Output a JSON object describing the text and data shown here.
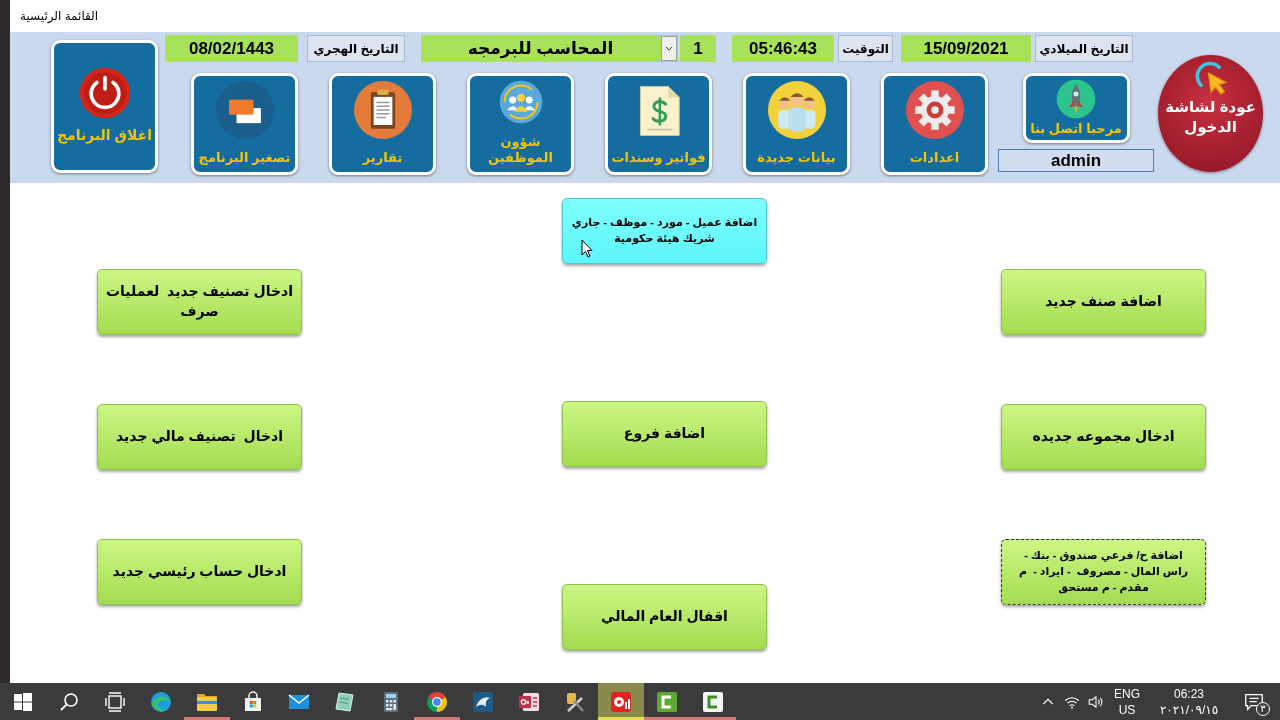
{
  "window": {
    "title": "القائمة الرئيسية"
  },
  "header": {
    "fields": [
      {
        "kind": "label",
        "text": "التاريخ الميلادي"
      },
      {
        "kind": "value",
        "text": "15/09/2021"
      },
      {
        "kind": "label",
        "text": "التوقيت"
      },
      {
        "kind": "value",
        "text": "05:46:43"
      },
      {
        "kind": "value",
        "text": "1"
      },
      {
        "kind": "combo",
        "text": "المحاسب للبرمجه"
      },
      {
        "kind": "label",
        "text": "التاريخ الهجري"
      },
      {
        "kind": "value",
        "text": "08/02/1443"
      }
    ],
    "login_button": {
      "label": "عودة لشاشة الدخول"
    },
    "user": {
      "tile_label": "مرحبا اتصل بنا",
      "username": "admin"
    },
    "tiles": [
      {
        "kind": "gear",
        "label": "اعدادات"
      },
      {
        "kind": "people",
        "label": "بيانات جديدة"
      },
      {
        "kind": "invoice",
        "label": "فواتير وسندات"
      },
      {
        "kind": "staff",
        "label": "شؤون الموظفين"
      },
      {
        "kind": "clipboard",
        "label": "تقارير"
      },
      {
        "kind": "windows",
        "label": "تصغير البرنامج"
      }
    ],
    "exit_button": {
      "label": "اغلاق البرنامج"
    }
  },
  "actions": {
    "columns": [
      {
        "buttons": [
          {
            "label": "اضافة صنف جديد",
            "hovered": false,
            "focused": false
          },
          {
            "label": "ادخال مجموعه جديده",
            "hovered": false,
            "focused": false
          },
          {
            "label": "اضافة ح/ فرعي صندوق - بنك - راس المال - مصروف  - ايراد -  م مقدم - م مستحق",
            "hovered": false,
            "focused": true
          }
        ]
      },
      {
        "buttons": [
          {
            "label": "اضافة عميل - مورد - موظف - جاري شريك هيئة حكومية",
            "hovered": true,
            "focused": false
          },
          {
            "label": "اضافة فروع",
            "hovered": false,
            "focused": false
          },
          {
            "label": "اقفال العام المالي",
            "hovered": false,
            "focused": false
          }
        ]
      },
      {
        "buttons": [
          {
            "label": "ادخال تصنيف جديد  لعمليات صرف",
            "hovered": false,
            "focused": false
          },
          {
            "label": "ادخال  تصنيف مالي جديد",
            "hovered": false,
            "focused": false
          },
          {
            "label": "ادخال حساب رئيسي جديد",
            "hovered": false,
            "focused": false
          }
        ]
      }
    ]
  },
  "taskbar": {
    "apps": [
      {
        "kind": "start",
        "running": false,
        "selected": false
      },
      {
        "kind": "search",
        "running": false,
        "selected": false
      },
      {
        "kind": "taskview",
        "running": false,
        "selected": false
      },
      {
        "kind": "edge",
        "running": false,
        "selected": false
      },
      {
        "kind": "explorer",
        "running": true,
        "selected": false
      },
      {
        "kind": "store",
        "running": false,
        "selected": false
      },
      {
        "kind": "mail",
        "running": false,
        "selected": false
      },
      {
        "kind": "notes",
        "running": false,
        "selected": false
      },
      {
        "kind": "calculator",
        "running": false,
        "selected": false
      },
      {
        "kind": "chrome",
        "running": true,
        "selected": false
      },
      {
        "kind": "database",
        "running": false,
        "selected": false
      },
      {
        "kind": "access",
        "running": false,
        "selected": false
      },
      {
        "kind": "tools",
        "running": false,
        "selected": false
      },
      {
        "kind": "recorder",
        "running": true,
        "selected": true
      },
      {
        "kind": "studio",
        "running": true,
        "selected": false
      },
      {
        "kind": "capture",
        "running": true,
        "selected": false
      }
    ],
    "tray": {
      "input_language": "ENG",
      "input_region": "US",
      "time": "06:23",
      "date": "٢٠٢١/٠٩/١٥",
      "notification_count": "٣"
    }
  }
}
